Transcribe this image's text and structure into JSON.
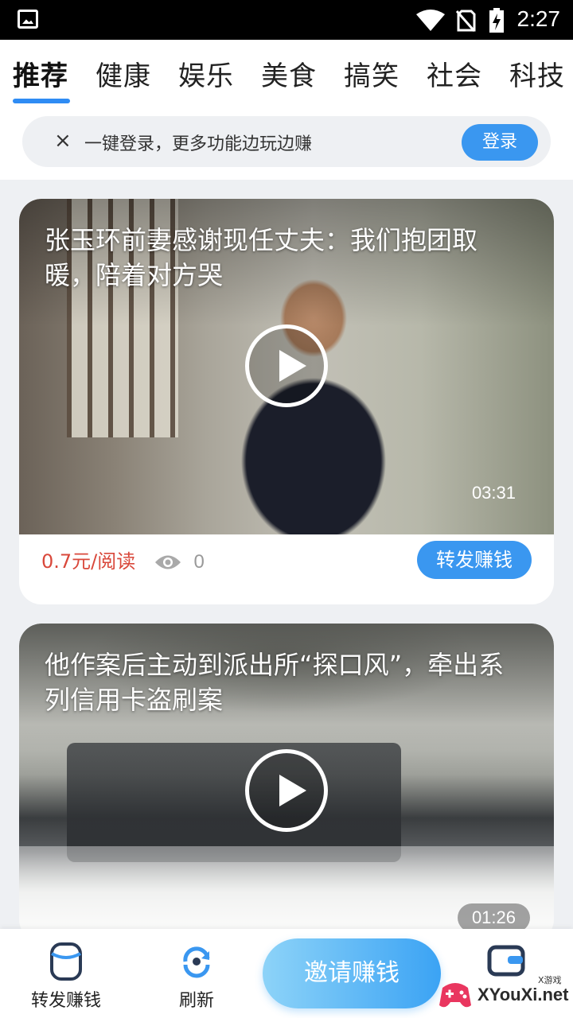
{
  "status_bar": {
    "time": "2:27"
  },
  "tabs": [
    {
      "label": "推荐",
      "active": true
    },
    {
      "label": "健康"
    },
    {
      "label": "娱乐"
    },
    {
      "label": "美食"
    },
    {
      "label": "搞笑"
    },
    {
      "label": "社会"
    },
    {
      "label": "科技"
    }
  ],
  "login_banner": {
    "close": "×",
    "text": "一键登录，更多功能边玩边赚",
    "button": "登录"
  },
  "feed": [
    {
      "title": "张玉环前妻感谢现任丈夫：我们抱团取暖，陪着对方哭",
      "duration": "03:31",
      "price": "0.7元/阅读",
      "views": "0",
      "share_label": "转发赚钱"
    },
    {
      "title": "他作案后主动到派出所“探口风”，牵出系列信用卡盗刷案",
      "duration": "01:26"
    }
  ],
  "bottom_nav": {
    "share": "转发赚钱",
    "refresh": "刷新",
    "invite": "邀请赚钱"
  },
  "watermark": {
    "site": "XYouXi.net",
    "small": "X游戏"
  },
  "colors": {
    "accent": "#3a97f0",
    "price": "#d9483b"
  },
  "icons": [
    "gallery-icon",
    "wifi-icon",
    "no-sim-icon",
    "battery-icon",
    "close-icon",
    "play-icon",
    "eye-icon",
    "share-cylinder-icon",
    "refresh-icon",
    "wallet-icon"
  ]
}
